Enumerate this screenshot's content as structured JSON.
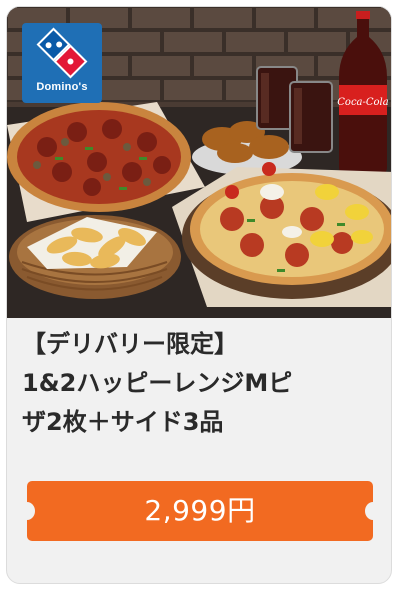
{
  "brand": {
    "logo_text": "Domino's",
    "logo_color": "#1f6fb5"
  },
  "product": {
    "title_lines": [
      "【デリバリー限定】",
      "1&2ハッピーレンジMピ",
      "ザ2枚＋サイド3品"
    ],
    "image_alt": "pizza-set-photo"
  },
  "bottle_label": "Coca-Cola",
  "price": {
    "label": "2,999円",
    "button_color": "#f26a21"
  }
}
